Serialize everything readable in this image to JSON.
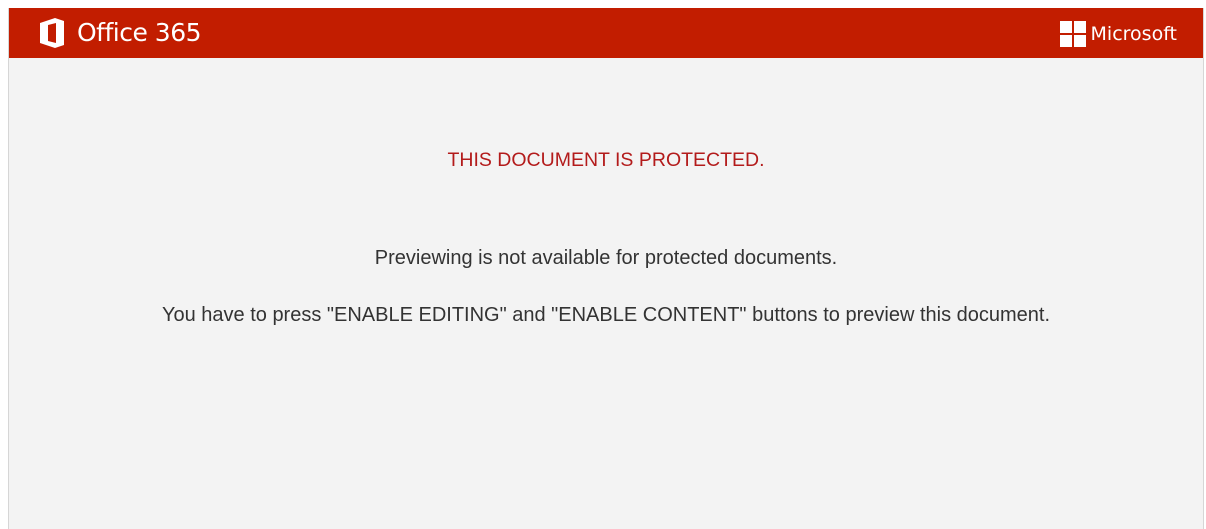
{
  "header": {
    "product_name": "Office 365",
    "vendor_name": "Microsoft",
    "background_color": "#c21d00",
    "product_icon": "office-logo-icon",
    "vendor_icon": "windows-logo-icon"
  },
  "main": {
    "warning_title": "THIS DOCUMENT IS PROTECTED.",
    "warning_color": "#b31b1b",
    "message_line_1": "Previewing is not available for protected documents.",
    "message_line_2": "You have to press \"ENABLE EDITING\" and \"ENABLE CONTENT\" buttons to preview this document."
  }
}
